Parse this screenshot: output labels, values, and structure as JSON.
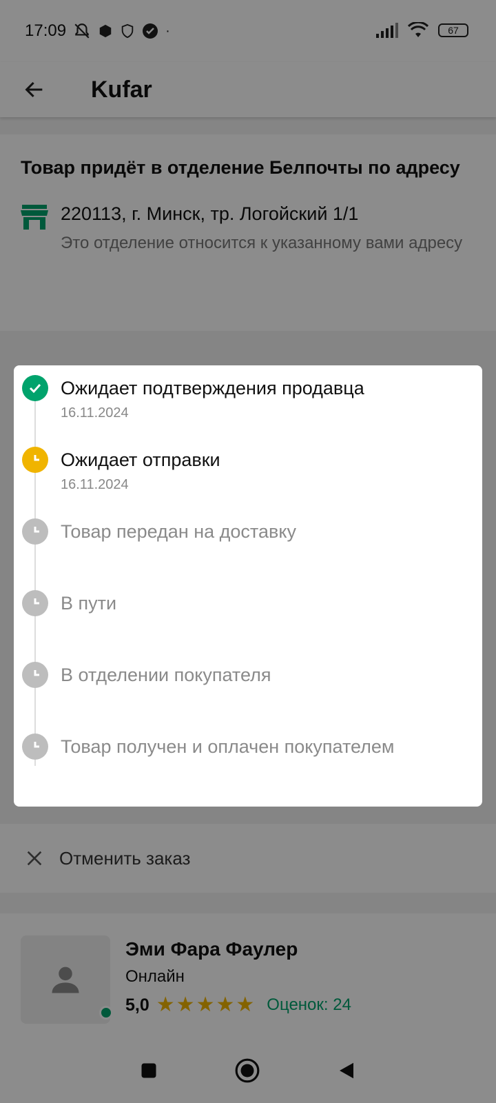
{
  "status_bar": {
    "time": "17:09",
    "battery": "67"
  },
  "app_bar": {
    "title": "Kufar"
  },
  "address": {
    "heading": "Товар придёт в отделение Белпочты по адресу",
    "line": "220113, г. Минск, тр. Логойский 1/1",
    "note": "Это отделение относится к указанному вами адресу"
  },
  "timeline": {
    "steps": [
      {
        "label": "Ожидает подтверждения продавца",
        "date": "16.11.2024",
        "state": "done"
      },
      {
        "label": "Ожидает отправки",
        "date": "16.11.2024",
        "state": "current"
      },
      {
        "label": "Товар передан на доставку",
        "state": "pending"
      },
      {
        "label": "В пути",
        "state": "pending"
      },
      {
        "label": "В отделении покупателя",
        "state": "pending"
      },
      {
        "label": "Товар получен и оплачен покупателем",
        "state": "pending"
      }
    ]
  },
  "cancel": {
    "label": "Отменить заказ"
  },
  "seller": {
    "name": "Эми Фара Фаулер",
    "status": "Онлайн",
    "rating": "5,0",
    "rating_count": "Оценок: 24",
    "stars": 5
  },
  "colors": {
    "accent_green": "#00a36c",
    "pending_orange": "#f0b400",
    "inactive_grey": "#bdbdbd"
  }
}
